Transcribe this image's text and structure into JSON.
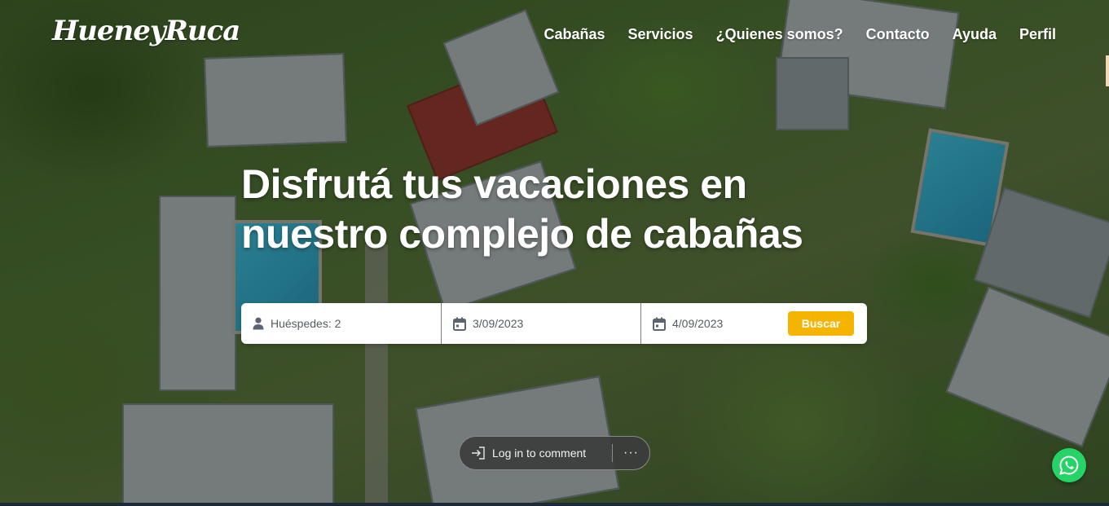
{
  "header": {
    "logo_text": "HueneyRuca",
    "nav": [
      {
        "label": "Cabañas"
      },
      {
        "label": "Servicios"
      },
      {
        "label": "¿Quienes somos?"
      },
      {
        "label": "Contacto"
      },
      {
        "label": "Ayuda"
      },
      {
        "label": "Perfil"
      }
    ]
  },
  "hero": {
    "title_line1": "Disfrutá tus vacaciones en",
    "title_line2": "nuestro complejo de cabañas"
  },
  "booking": {
    "guests_value": "Huéspedes: 2",
    "checkin_value": "3/09/2023",
    "checkout_value": "4/09/2023",
    "search_label": "Buscar",
    "icons": {
      "guests": "person-icon",
      "checkin": "calendar-icon",
      "checkout": "calendar-icon"
    }
  },
  "comment_pill": {
    "login_label": "Log in to comment",
    "more_label": "···",
    "icons": {
      "login": "sign-in-icon",
      "more": "more-icon"
    }
  },
  "floating": {
    "whatsapp_icon": "whatsapp-icon"
  },
  "colors": {
    "accent": "#f5b400",
    "text_on_hero": "#ffffff",
    "whatsapp": "#25d366"
  }
}
